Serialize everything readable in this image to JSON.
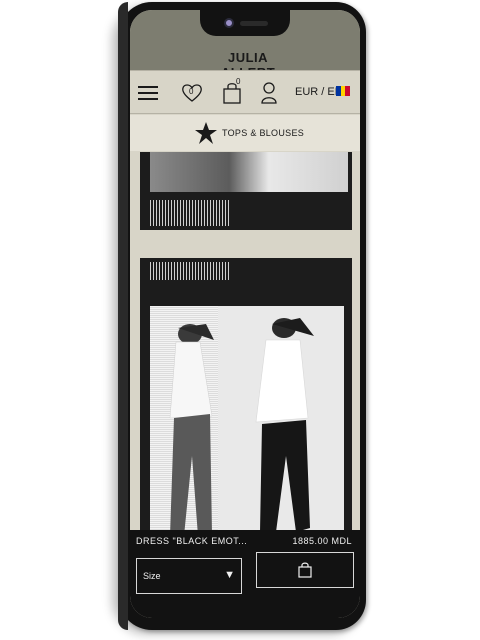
{
  "brand": {
    "logo_text": "JULIA ALLERT"
  },
  "nav": {
    "menu_icon": "hamburger-icon",
    "wishlist_icon": "heart-icon",
    "wishlist_count": "0",
    "cart_icon": "bag-icon",
    "cart_count": "0",
    "account_icon": "user-icon",
    "currency_lang": "EUR / EN",
    "flag_colors": [
      "#0033a0",
      "#ffd200",
      "#cc092f"
    ]
  },
  "category": {
    "icon": "brand-star-icon",
    "title": "TOPS & BLOUSES"
  },
  "product": {
    "name": "DRESS \"BLACK EMOT...",
    "price": "1885.00 MDL",
    "size_label": "Size",
    "size_caret": "▼",
    "cart_icon": "bag-icon"
  },
  "colors": {
    "bezel": "#121212",
    "header": "#7d7d70",
    "nav_bg": "#d8d5c8",
    "info_bg": "#121212"
  }
}
